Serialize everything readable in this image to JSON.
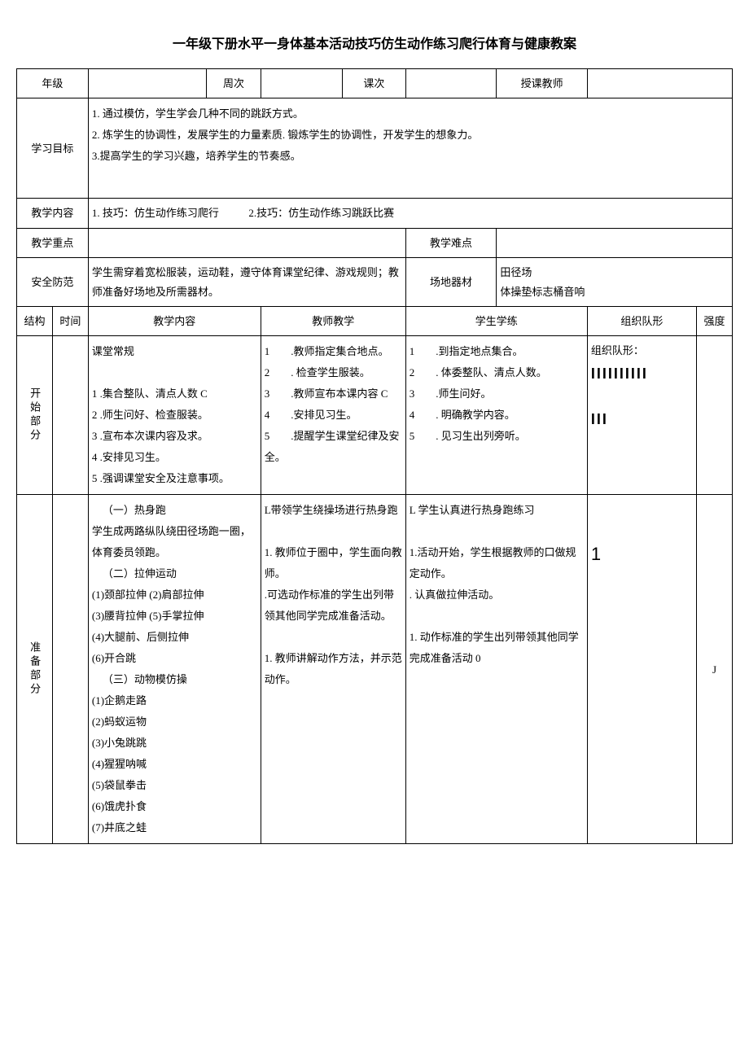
{
  "title": "一年级下册水平一身体基本活动技巧仿生动作练习爬行体育与健康教案",
  "header": {
    "grade_label": "年级",
    "grade_value": "",
    "week_label": "周次",
    "week_value": "",
    "lesson_label": "课次",
    "lesson_value": "",
    "teacher_label": "授课教师",
    "teacher_value": ""
  },
  "goals": {
    "label": "学习目标",
    "line1": "1. 通过模仿，学生学会几种不同的跳跃方式。",
    "line2": "2. 炼学生的协调性，发展学生的力量素质. 锻炼学生的协调性，开发学生的想象力。",
    "line3": "3.提高学生的学习兴趣，培养学生的节奏感。"
  },
  "content": {
    "label": "教学内容",
    "item1": "1. 技巧：仿生动作练习爬行",
    "item2": "2.技巧：仿生动作练习跳跃比赛"
  },
  "key": {
    "label": "教学重点",
    "value": ""
  },
  "difficulty": {
    "label": "教学难点",
    "value": ""
  },
  "safety": {
    "label": "安全防范",
    "value": "学生需穿着宽松服装，运动鞋，遵守体育课堂纪律、游戏规则；教师准备好场地及所需器材。"
  },
  "venue": {
    "label": "场地器材",
    "line1": "田径场",
    "line2": "体操垫标志桶音响"
  },
  "columns": {
    "structure": "结构",
    "time": "时间",
    "teaching_content": "教学内容",
    "teacher_activity": "教师教学",
    "student_activity": "学生学练",
    "formation": "组织队形",
    "intensity": "强度"
  },
  "section1": {
    "name": "开始部分",
    "time": "",
    "content_title": "课堂常规",
    "content_items": [
      "1 .集合整队、清点人数 C",
      "2 .师生问好、检查服装。",
      "3 .宣布本次课内容及求。",
      "4 .安排见习生。",
      "5 .强调课堂安全及注意事项。"
    ],
    "teacher_items": [
      "1　　.教师指定集合地点。",
      "2　　. 检查学生服装。",
      "3　　.教师宣布本课内容 C",
      "4　　.安排见习生。",
      "5　　.提醒学生课堂纪律及安全。"
    ],
    "student_items": [
      "1　　.到指定地点集合。",
      "2　　. 体委整队、清点人数。",
      "3　　.师生问好。",
      "4　　. 明确教学内容。",
      "5　　. 见习生出列旁听。"
    ],
    "formation_label": "组织队形：",
    "formation_bars1": "IIIIIIIIII",
    "formation_bars2": "III",
    "intensity": ""
  },
  "section2": {
    "name": "准备部分",
    "time": "",
    "content_h1": "（一）热身跑",
    "content_p1": "学生成两路纵队绕田径场跑一圈，体育委员领跑。",
    "content_h2": "（二）拉伸运动",
    "content_stretch": [
      "(1)颈部拉伸 (2)肩部拉伸",
      "(3)腰背拉伸 (5)手掌拉伸",
      "(4)大腿前、后侧拉伸",
      "(6)开合跳"
    ],
    "content_h3": "（三）动物模仿操",
    "content_animals": [
      "(1)企鹅走路",
      "(2)蚂蚁运物",
      "(3)小兔跳跳",
      "(4)猩猩呐喊",
      "(5)袋鼠拳击",
      "(6)饿虎扑食",
      "(7)井底之蛙"
    ],
    "teacher_items": [
      "L带领学生绕操场进行热身跑",
      "1. 教师位于圈中，学生面向教师。",
      ".可选动作标准的学生出列带领其他同学完成准备活动。",
      "1. 教师讲解动作方法，并示范动作。"
    ],
    "student_items": [
      "L 学生认真进行热身跑练习",
      "1.活动开始，学生根据教师的口做规定动作。",
      ". 认真做拉伸活动。",
      "1. 动作标准的学生出列带领其他同学完成准备活动 0"
    ],
    "formation_marker": "1",
    "intensity": "J"
  }
}
